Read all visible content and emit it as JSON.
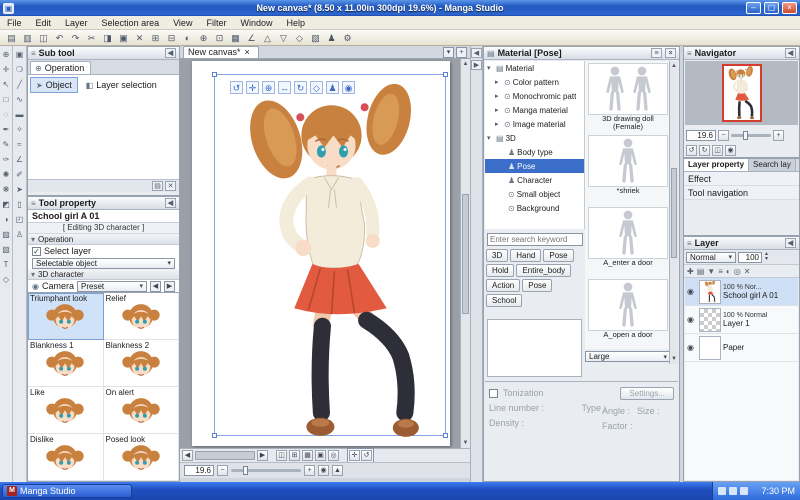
{
  "window": {
    "title": "New canvas* (8.50 x 11.00in 300dpi 19.6%) - Manga Studio",
    "app_icon": "▣",
    "minimize": "–",
    "maximize": "▢",
    "close": "×"
  },
  "glyphs": {
    "left": "◀",
    "right": "▶",
    "up": "▲",
    "down": "▼",
    "chevron": "▾",
    "check": "✓",
    "eye": "◉",
    "menu": "≡",
    "plus": "+",
    "minus": "−",
    "close": "×"
  },
  "menu": {
    "items": [
      "File",
      "Edit",
      "Layer",
      "Selection area",
      "View",
      "Filter",
      "Window",
      "Help"
    ]
  },
  "toolbar": {
    "icons": [
      {
        "name": "new-canvas-icon",
        "glyph": "▤"
      },
      {
        "name": "open-file-icon",
        "glyph": "▥"
      },
      {
        "name": "save-file-icon",
        "glyph": "◫"
      },
      {
        "name": "undo-icon",
        "glyph": "↶"
      },
      {
        "name": "redo-icon",
        "glyph": "↷"
      },
      {
        "name": "cut-icon",
        "glyph": "✂"
      },
      {
        "name": "copy-icon",
        "glyph": "◨"
      },
      {
        "name": "paste-icon",
        "glyph": "▣"
      },
      {
        "name": "delete-icon",
        "glyph": "✕"
      },
      {
        "name": "select-all-icon",
        "glyph": "⊞"
      },
      {
        "name": "deselect-icon",
        "glyph": "⊟"
      },
      {
        "name": "invert-selection-icon",
        "glyph": "◐"
      },
      {
        "name": "zoom-icon",
        "glyph": "⊕"
      },
      {
        "name": "fit-screen-icon",
        "glyph": "⊡"
      },
      {
        "name": "grid-icon",
        "glyph": "▦"
      },
      {
        "name": "ruler-icon",
        "glyph": "∠"
      },
      {
        "name": "snap-ruler-icon",
        "glyph": "△"
      },
      {
        "name": "snap-special-icon",
        "glyph": "▽"
      },
      {
        "name": "snap-grid-icon",
        "glyph": "◇"
      },
      {
        "name": "material-palette-icon",
        "glyph": "▧"
      },
      {
        "name": "pose-icon",
        "glyph": "♟"
      },
      {
        "name": "settings-icon",
        "glyph": "⚙"
      }
    ]
  },
  "left_tools": {
    "a": [
      {
        "name": "zoom-tool",
        "glyph": "⊕"
      },
      {
        "name": "move-tool",
        "glyph": "✛"
      },
      {
        "name": "operation-tool",
        "glyph": "↖"
      },
      {
        "name": "selection-tool",
        "glyph": "□"
      },
      {
        "name": "lasso-tool",
        "glyph": "◌"
      },
      {
        "name": "pen-tool",
        "glyph": "✒"
      },
      {
        "name": "pencil-tool",
        "glyph": "✎"
      },
      {
        "name": "brush-tool",
        "glyph": "✑"
      },
      {
        "name": "airbrush-tool",
        "glyph": "✺"
      },
      {
        "name": "decoration-tool",
        "glyph": "❋"
      },
      {
        "name": "eraser-tool",
        "glyph": "◩"
      },
      {
        "name": "blend-tool",
        "glyph": "◑"
      },
      {
        "name": "fill-tool",
        "glyph": "▨"
      },
      {
        "name": "gradient-tool",
        "glyph": "▧"
      },
      {
        "name": "text-tool",
        "glyph": "T"
      },
      {
        "name": "figure-tool",
        "glyph": "◇"
      }
    ],
    "b": [
      {
        "name": "frame-border-tool",
        "glyph": "▣"
      },
      {
        "name": "balloon-tool",
        "glyph": "❍"
      },
      {
        "name": "line-tool",
        "glyph": "╱"
      },
      {
        "name": "curve-tool",
        "glyph": "∿"
      },
      {
        "name": "polygon-tool",
        "glyph": "▬"
      },
      {
        "name": "eyedropper-tool",
        "glyph": "✧"
      },
      {
        "name": "correct-line-tool",
        "glyph": "≈"
      },
      {
        "name": "ruler-tool",
        "glyph": "∠"
      },
      {
        "name": "select-pen-tool",
        "glyph": "✐"
      },
      {
        "name": "object-tool",
        "glyph": "➤"
      },
      {
        "name": "page-tool",
        "glyph": "▯"
      },
      {
        "name": "panel-tool",
        "glyph": "◰"
      },
      {
        "name": "3d-tool",
        "glyph": "♙"
      }
    ]
  },
  "subtool": {
    "title": "Sub tool",
    "tab": "Operation",
    "tab_icon": "⊕",
    "tools": [
      {
        "name": "subtool-object",
        "label": "Object",
        "glyph": "➤",
        "cls": "sel"
      },
      {
        "name": "subtool-layer-selection",
        "label": "Layer selection",
        "glyph": "◧"
      }
    ],
    "corner_icons": [
      {
        "name": "add-subtool-icon",
        "glyph": "▤"
      },
      {
        "name": "delete-subtool-icon",
        "glyph": "✕"
      }
    ]
  },
  "tool_property": {
    "title": "Tool property",
    "tool_name": "School girl A 01",
    "editing_note": "[ Editing 3D character ]",
    "section_operation": "Operation",
    "section_character": "3D character",
    "select_layer": "Select layer",
    "selectable_object": "Selectable object",
    "camera": "Camera",
    "preset": "Preset"
  },
  "expressions": {
    "items": [
      {
        "label": "Triumphant look",
        "cls": "sel"
      },
      {
        "label": "Relief"
      },
      {
        "label": "Blankness 1"
      },
      {
        "label": "Blankness 2"
      },
      {
        "label": "Like"
      },
      {
        "label": "On alert"
      },
      {
        "label": "Dislike"
      },
      {
        "label": "Posed look"
      }
    ]
  },
  "canvas": {
    "tab": "New canvas*",
    "zoom_value": "19.6",
    "object_toolbar": [
      {
        "name": "camera-rotate-icon",
        "glyph": "↺"
      },
      {
        "name": "camera-pan-icon",
        "glyph": "✛"
      },
      {
        "name": "camera-zoom-icon",
        "glyph": "⊕"
      },
      {
        "name": "object-move-icon",
        "glyph": "↔"
      },
      {
        "name": "object-rotate-icon",
        "glyph": "↻"
      },
      {
        "name": "object-scale-icon",
        "glyph": "◇"
      },
      {
        "name": "pose-edit-icon",
        "glyph": "♟"
      },
      {
        "name": "root-move-icon",
        "glyph": "◉"
      }
    ],
    "bottom_icons": [
      {
        "name": "flip-view-icon",
        "glyph": "◫"
      },
      {
        "name": "grid-toggle-icon",
        "glyph": "⊞"
      },
      {
        "name": "guide-toggle-icon",
        "glyph": "▦"
      },
      {
        "name": "trim-view-icon",
        "glyph": "▣"
      },
      {
        "name": "print-guide-icon",
        "glyph": "◎"
      }
    ],
    "frame_icons": [
      {
        "name": "hand-nav-icon",
        "glyph": "✛"
      },
      {
        "name": "rotate-nav-icon",
        "glyph": "↺"
      }
    ]
  },
  "material": {
    "title": "Material [Pose]",
    "header_icon": "▤",
    "search_placeholder": "Enter search keyword",
    "size_select": "Large",
    "tree": [
      {
        "label": "Material",
        "exp": "▾",
        "icon": "▤",
        "cls": "d0"
      },
      {
        "label": "Color pattern",
        "exp": "▸",
        "icon": "⊙",
        "cls": "d1"
      },
      {
        "label": "Monochromic patt",
        "exp": "▸",
        "icon": "⊙",
        "cls": "d1"
      },
      {
        "label": "Manga material",
        "exp": "▸",
        "icon": "⊙",
        "cls": "d1"
      },
      {
        "label": "Image material",
        "exp": "▸",
        "icon": "⊙",
        "cls": "d1"
      },
      {
        "label": "3D",
        "exp": "▾",
        "icon": "▤",
        "cls": "d0"
      },
      {
        "label": "Body type",
        "exp": "",
        "icon": "♟",
        "cls": "d2"
      },
      {
        "label": "Pose",
        "exp": "",
        "icon": "♟",
        "cls": "d2 sel"
      },
      {
        "label": "Character",
        "exp": "",
        "icon": "♟",
        "cls": "d2"
      },
      {
        "label": "Small object",
        "exp": "",
        "icon": "⊙",
        "cls": "d2"
      },
      {
        "label": "Background",
        "exp": "",
        "icon": "⊙",
        "cls": "d2"
      }
    ],
    "items": [
      {
        "label": "3D drawing doll (Female)",
        "cls": "pair"
      },
      {
        "label": "*shriek",
        "cls": "single"
      },
      {
        "label": "A_enter a door",
        "cls": "single"
      },
      {
        "label": "A_open a door",
        "cls": "single"
      }
    ],
    "tags": [
      "3D",
      "Hand",
      "Pose",
      "Hold",
      "Entire_body",
      "Action",
      "Pose",
      "School"
    ],
    "props": {
      "tonization": "Tonization",
      "settings": "Settings...",
      "rows": [
        {
          "l": "Line number :",
          "r": "Angle :"
        },
        {
          "l": "Type :",
          "r": "Size :"
        },
        {
          "l": "Density :",
          "r": "Factor :"
        }
      ]
    }
  },
  "navigator": {
    "title": "Navigator",
    "zoom_value": "19.6",
    "icons": [
      {
        "name": "rotate-left-icon",
        "glyph": "↺"
      },
      {
        "name": "rotate-right-icon",
        "glyph": "↻"
      },
      {
        "name": "flip-horizontal-icon",
        "glyph": "◫"
      },
      {
        "name": "reset-view-icon",
        "glyph": "◉"
      }
    ]
  },
  "layer_property": {
    "tabs": [
      {
        "label": "Layer property",
        "cls": "on"
      },
      {
        "label": "Search lay"
      }
    ],
    "effect_label": "Effect",
    "tool_nav_label": "Tool navigation"
  },
  "layers": {
    "title": "Layer",
    "blend_mode": "Normal",
    "opacity": "100",
    "header_icons": [
      {
        "name": "new-layer-icon",
        "glyph": "✚"
      },
      {
        "name": "new-folder-icon",
        "glyph": "▤"
      },
      {
        "name": "transfer-down-icon",
        "glyph": "▼"
      },
      {
        "name": "combine-below-icon",
        "glyph": "≡"
      },
      {
        "name": "mask-icon",
        "glyph": "◐"
      },
      {
        "name": "onion-skin-icon",
        "glyph": "◎"
      },
      {
        "name": "delete-layer-icon",
        "glyph": "✕"
      }
    ],
    "items": [
      {
        "name": "School girl A 01",
        "info": "100 % Nor...",
        "cls": "sel t-chara"
      },
      {
        "name": "Layer 1",
        "info": "100 % Normal",
        "cls": "t-checker"
      },
      {
        "name": "Paper",
        "info": "",
        "cls": "t-paper"
      }
    ]
  },
  "taskbar": {
    "app_label": "Manga Studio",
    "app_initial": "M",
    "time": "7:30 PM"
  }
}
